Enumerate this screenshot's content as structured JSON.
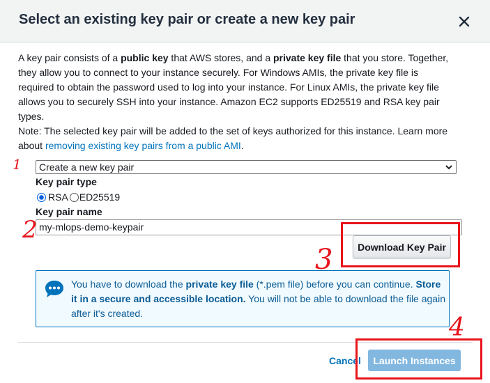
{
  "dialog": {
    "title": "Select an existing key pair or create a new key pair",
    "close_icon": "close-icon"
  },
  "intro": {
    "t1": "A key pair consists of a ",
    "b1": "public key",
    "t2": " that AWS stores, and a ",
    "b2": "private key file",
    "t3": " that you store. Together, they allow you to connect to your instance securely. For Windows AMIs, the private key file is required to obtain the password used to log into your instance. For Linux AMIs, the private key file allows you to securely SSH into your instance. Amazon EC2 supports ED25519 and RSA key pair types."
  },
  "note": {
    "text": "Note: The selected key pair will be added to the set of keys authorized for this instance. Learn more about ",
    "link": "removing existing key pairs from a public AMI",
    "end": "."
  },
  "form": {
    "selected_option": "Create a new key pair",
    "key_type_label": "Key pair type",
    "rsa_label": "RSA",
    "ed_label": "ED25519",
    "selected_type": "RSA",
    "key_name_label": "Key pair name",
    "key_name_value": "my-mlops-demo-keypair",
    "download_label": "Download Key Pair"
  },
  "info": {
    "icon": "chat-bubble-icon",
    "t1": "You have to download the ",
    "b1": "private key file",
    "t2": " (*.pem file) before you can continue. ",
    "b2": "Store it in a secure and accessible location.",
    "t3": " You will not be able to download the file again after it's created."
  },
  "footer": {
    "cancel_label": "Cancel",
    "launch_label": "Launch Instances"
  },
  "annotations": {
    "color": "#e8141c",
    "numbers": [
      "1",
      "2",
      "3",
      "4"
    ]
  },
  "colors": {
    "link": "#0073bb",
    "info_border": "#0073bb",
    "launch_disabled": "#82b7e0"
  }
}
